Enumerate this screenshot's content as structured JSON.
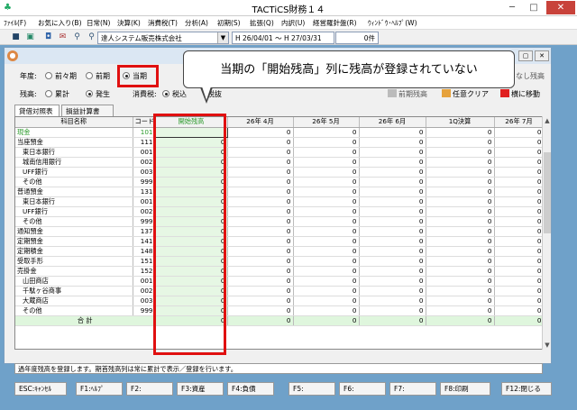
{
  "window": {
    "title": "TACTiCS財務１４"
  },
  "menubar": [
    "ﾌｧｲﾙ(F)",
    "お気に入り(B)",
    "日常(N)",
    "決算(K)",
    "消費税(T)",
    "分析(A)",
    "初期(S)",
    "拡張(Q)",
    "内訳(U)",
    "経営羅針盤(R)",
    "ｳｨﾝﾄﾞｳ･ﾍﾙﾌﾟ(W)"
  ],
  "toolbar": {
    "company": "達人システム販売株式会社",
    "period": "H 26/04/01 ～ H 27/03/31",
    "count": "0件"
  },
  "options": {
    "nendo_label": "年度:",
    "nendo_options": [
      "前々期",
      "前期",
      "当期"
    ],
    "nendo_selected": "当期",
    "zandaka_label": "残高:",
    "zandaka_options": [
      "累計",
      "発生"
    ],
    "zandaka_selected": "発生",
    "tax_label": "消費税:",
    "tax_option": "税込",
    "tax_suffix": "税抜"
  },
  "callout": "当期の「開始残高」列に残高が登録されていない",
  "right_buttons": {
    "zero_hide": "なし残高",
    "prev_copy": "前期残高",
    "clear": "任意クリア",
    "move": "横に移動"
  },
  "tabs": [
    "貸借対照表",
    "損益計算書"
  ],
  "grid": {
    "headers": [
      "科目名称",
      "コード",
      "開始残高",
      "26年 4月",
      "26年 5月",
      "26年 6月",
      "1Q決算",
      "26年 7月"
    ],
    "rows": [
      {
        "name": "現金",
        "code": "101",
        "vals": [
          "",
          "0",
          "0",
          "0",
          "0",
          "0"
        ]
      },
      {
        "name": "当座預金",
        "code": "111",
        "vals": [
          "0",
          "0",
          "0",
          "0",
          "0",
          "0"
        ]
      },
      {
        "name": "東日本銀行",
        "code": "001",
        "vals": [
          "0",
          "0",
          "0",
          "0",
          "0",
          "0"
        ]
      },
      {
        "name": "城南信用銀行",
        "code": "002",
        "vals": [
          "0",
          "0",
          "0",
          "0",
          "0",
          "0"
        ]
      },
      {
        "name": "UFF銀行",
        "code": "003",
        "vals": [
          "0",
          "0",
          "0",
          "0",
          "0",
          "0"
        ]
      },
      {
        "name": "その他",
        "code": "999",
        "vals": [
          "0",
          "0",
          "0",
          "0",
          "0",
          "0"
        ]
      },
      {
        "name": "普通預金",
        "code": "131",
        "vals": [
          "0",
          "0",
          "0",
          "0",
          "0",
          "0"
        ]
      },
      {
        "name": "東日本銀行",
        "code": "001",
        "vals": [
          "0",
          "0",
          "0",
          "0",
          "0",
          "0"
        ]
      },
      {
        "name": "UFF銀行",
        "code": "002",
        "vals": [
          "0",
          "0",
          "0",
          "0",
          "0",
          "0"
        ]
      },
      {
        "name": "その他",
        "code": "999",
        "vals": [
          "0",
          "0",
          "0",
          "0",
          "0",
          "0"
        ]
      },
      {
        "name": "通知預金",
        "code": "137",
        "vals": [
          "0",
          "0",
          "0",
          "0",
          "0",
          "0"
        ]
      },
      {
        "name": "定期預金",
        "code": "141",
        "vals": [
          "0",
          "0",
          "0",
          "0",
          "0",
          "0"
        ]
      },
      {
        "name": "定期積金",
        "code": "148",
        "vals": [
          "0",
          "0",
          "0",
          "0",
          "0",
          "0"
        ]
      },
      {
        "name": "受取手形",
        "code": "151",
        "vals": [
          "0",
          "0",
          "0",
          "0",
          "0",
          "0"
        ]
      },
      {
        "name": "売掛金",
        "code": "152",
        "vals": [
          "0",
          "0",
          "0",
          "0",
          "0",
          "0"
        ]
      },
      {
        "name": "山田商店",
        "code": "001",
        "vals": [
          "0",
          "0",
          "0",
          "0",
          "0",
          "0"
        ]
      },
      {
        "name": "千駄ヶ谷商事",
        "code": "002",
        "vals": [
          "0",
          "0",
          "0",
          "0",
          "0",
          "0"
        ]
      },
      {
        "name": "大蔵商店",
        "code": "003",
        "vals": [
          "0",
          "0",
          "0",
          "0",
          "0",
          "0"
        ]
      },
      {
        "name": "その他",
        "code": "999",
        "vals": [
          "0",
          "0",
          "0",
          "0",
          "0",
          "0"
        ]
      }
    ],
    "total": {
      "name": "合 計",
      "vals": [
        "0",
        "0",
        "0",
        "0",
        "0",
        "0"
      ]
    }
  },
  "status": "過年度残高を登録します。期首残高列は常に累計で表示／登録を行います。",
  "fkeys": [
    "ESC:ｷｬﾝｾﾙ",
    "F1:ﾍﾙﾌﾟ",
    "F2:",
    "F3:資産",
    "F4:負債",
    "F5:",
    "F6:",
    "F7:",
    "F8:印刷",
    "F12:閉じる"
  ]
}
